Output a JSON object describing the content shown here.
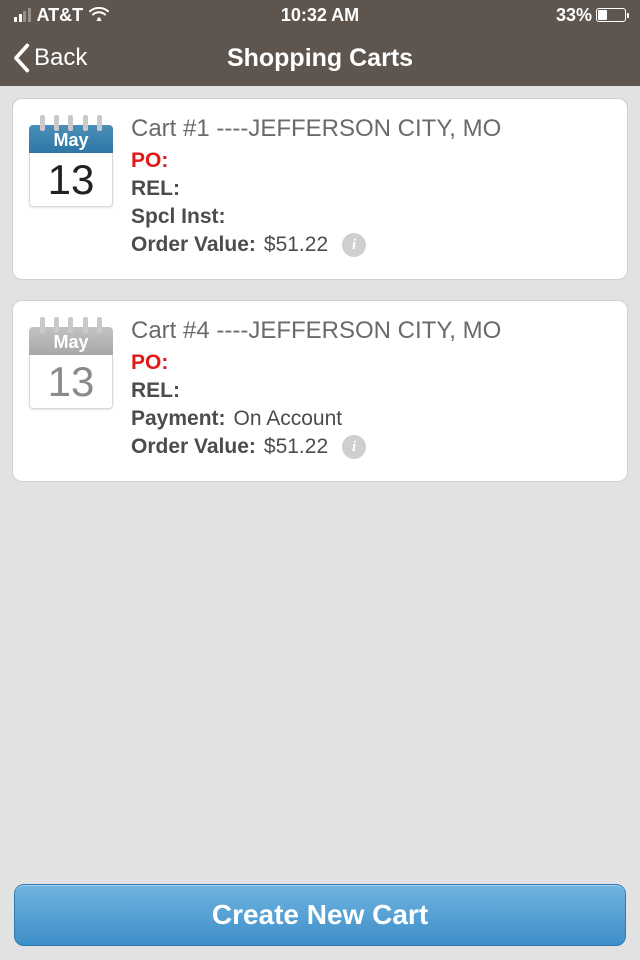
{
  "status": {
    "carrier": "AT&T",
    "time": "10:32 AM",
    "battery": "33%"
  },
  "nav": {
    "back": "Back",
    "title": "Shopping Carts"
  },
  "carts": [
    {
      "month": "May",
      "day": "13",
      "color": "blue",
      "title": "Cart #1  ----JEFFERSON CITY, MO",
      "po_label": "PO:",
      "rel_label": "REL:",
      "extra_label": "Spcl Inst:",
      "extra_value": "",
      "value_label": "Order Value:",
      "value": "$51.22"
    },
    {
      "month": "May",
      "day": "13",
      "color": "gray",
      "title": "Cart #4  ----JEFFERSON CITY, MO",
      "po_label": "PO:",
      "rel_label": "REL:",
      "extra_label": "Payment:",
      "extra_value": "On Account",
      "value_label": "Order Value:",
      "value": "$51.22"
    }
  ],
  "footer": {
    "button": "Create New Cart"
  }
}
